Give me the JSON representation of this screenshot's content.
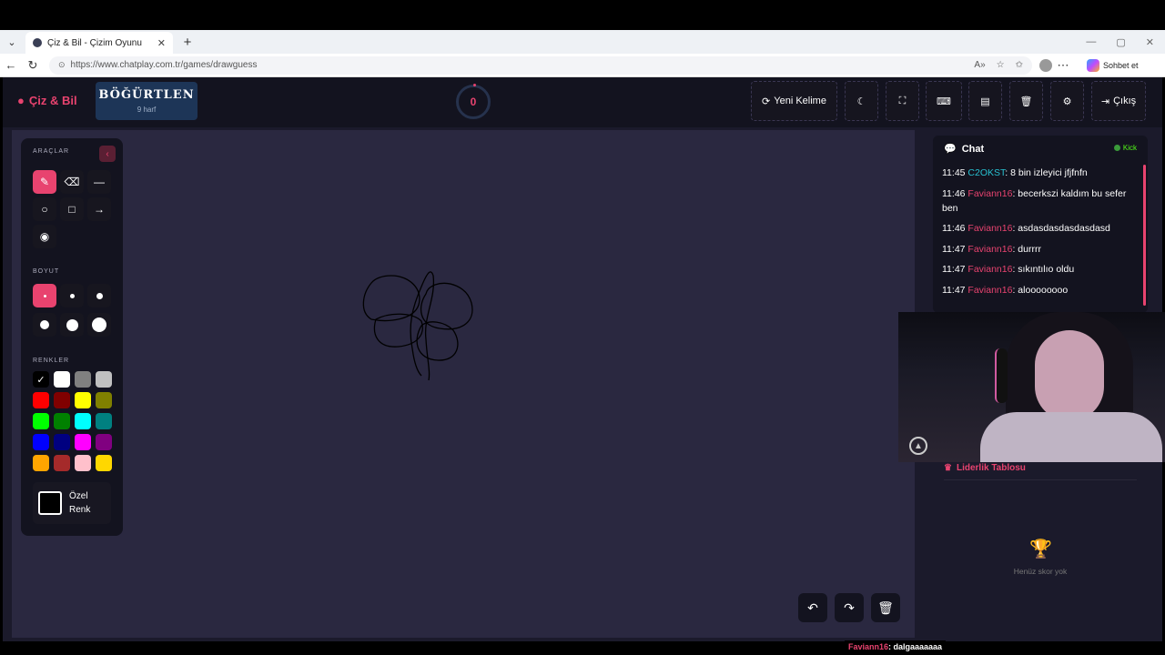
{
  "browser": {
    "tab_title": "Çiz & Bil - Çizim Oyunu",
    "url": "https://www.chatplay.com.tr/games/drawguess",
    "sohbet_label": "Sohbet et"
  },
  "header": {
    "logo": "Çiz & Bil",
    "word": "BÖĞÜRTLEN",
    "letters": "9 harf",
    "timer": "0",
    "new_word": "Yeni Kelime",
    "logout": "Çıkış"
  },
  "tools": {
    "label_tools": "ARAÇLAR",
    "label_size": "BOYUT",
    "label_colors": "RENKLER",
    "custom_line1": "Özel",
    "custom_line2": "Renk"
  },
  "colors": {
    "accent": "#e8436f",
    "palette": [
      "#000000",
      "#ffffff",
      "#808080",
      "#c0c0c0",
      "#ff0000",
      "#800000",
      "#ffff00",
      "#808000",
      "#00ff00",
      "#008000",
      "#00ffff",
      "#008080",
      "#0000ff",
      "#000080",
      "#ff00ff",
      "#800080",
      "#ffa500",
      "#a52a2a",
      "#ffc0cb",
      "#ffd700"
    ]
  },
  "chat": {
    "title": "Chat",
    "platform": "Kick",
    "messages": [
      {
        "time": "11:45",
        "user": "C2OKST",
        "text": ": 8 bin izleyici jfjfnfn"
      },
      {
        "time": "11:46",
        "user": "Faviann16",
        "text": ": becerkszi kaldım bu sefer ben"
      },
      {
        "time": "11:46",
        "user": "Faviann16",
        "text": ": asdasdasdasdasdasd"
      },
      {
        "time": "11:47",
        "user": "Faviann16",
        "text": ": durrrr"
      },
      {
        "time": "11:47",
        "user": "Faviann16",
        "text": ": sıkıntılıo oldu"
      },
      {
        "time": "11:47",
        "user": "Faviann16",
        "text": ": aloooooooo"
      }
    ]
  },
  "leaderboard": {
    "title": "Liderlik Tablosu",
    "empty": "Henüz skor yok"
  },
  "ticker": {
    "user": "Faviann16",
    "text": " : dalgaaaaaaa"
  }
}
